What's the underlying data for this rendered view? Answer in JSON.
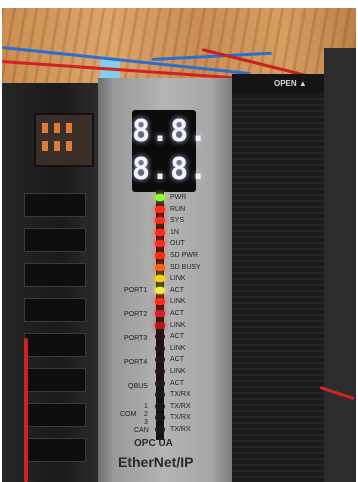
{
  "display": {
    "top_digits": "8.8.",
    "bottom_digits": "8.8."
  },
  "status_leds": [
    {
      "label": "PWR",
      "color": "#8fff3a",
      "lit": true
    },
    {
      "label": "RUN",
      "color": "#ff2a1a",
      "lit": true
    },
    {
      "label": "SYS",
      "color": "#ff2a1a",
      "lit": true
    },
    {
      "label": "1N",
      "color": "#ff2a1a",
      "lit": true
    },
    {
      "label": "OUT",
      "color": "#ff2a1a",
      "lit": true
    },
    {
      "label": "SD PWR",
      "color": "#ff2a1a",
      "lit": true
    },
    {
      "label": "SD BUSY",
      "color": "#ff5a1a",
      "lit": true
    },
    {
      "label": "LINK",
      "color": "#ffd21a",
      "lit": true
    },
    {
      "label": "ACT",
      "color": "#ffe84a",
      "lit": true
    },
    {
      "label": "LINK",
      "color": "#ff2a1a",
      "lit": true
    },
    {
      "label": "ACT",
      "color": "#d42020",
      "lit": true
    },
    {
      "label": "LINK",
      "color": "#b01818",
      "lit": true
    },
    {
      "label": "ACT",
      "color": "#2a1414",
      "lit": false
    },
    {
      "label": "LINK",
      "color": "#2a1414",
      "lit": false
    },
    {
      "label": "ACT",
      "color": "#2a1414",
      "lit": false
    },
    {
      "label": "LINK",
      "color": "#2a1414",
      "lit": false
    },
    {
      "label": "ACT",
      "color": "#2a1414",
      "lit": false
    },
    {
      "label": "TX/RX",
      "color": "#1a1a1a",
      "lit": false
    },
    {
      "label": "TX/RX",
      "color": "#1a1a1a",
      "lit": false
    },
    {
      "label": "TX/RX",
      "color": "#1a1a1a",
      "lit": false
    },
    {
      "label": "TX/RX",
      "color": "#1a1a1a",
      "lit": false
    }
  ],
  "ports": [
    "PORT1",
    "PORT2",
    "PORT3",
    "PORT4",
    "QBUS"
  ],
  "com": {
    "label": "COM",
    "numbers": [
      "1",
      "2",
      "3"
    ],
    "can": "CAN"
  },
  "logo": {
    "opc": "OPC UA",
    "ethernet": "EtherNet/IP"
  },
  "right_module": {
    "open_label": "OPEN ▲"
  },
  "colors": {
    "wood": "#d29a5e",
    "module_gray": "#a8a8a8",
    "module_black": "#1d1d1d",
    "wire_red": "#d42020",
    "wire_blue": "#2a6fd0"
  }
}
